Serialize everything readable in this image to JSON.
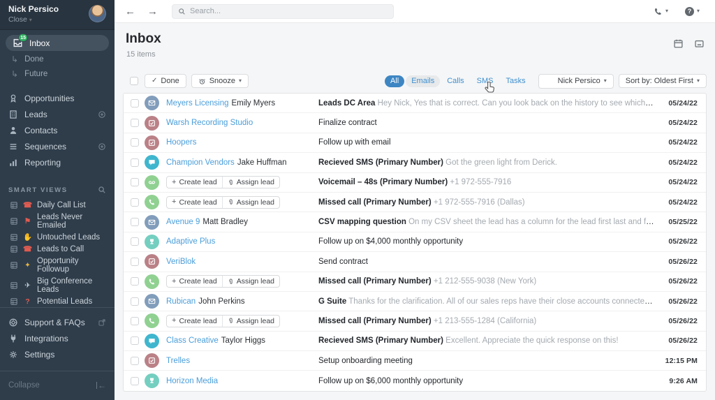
{
  "colors": {
    "accent_blue": "#4a9eda",
    "filter_active_bg": "#3d86c3",
    "badge_green": "#2eae5f",
    "icon_email": "#819dbb",
    "icon_task": "#ba8187",
    "icon_sms": "#3fb6ce",
    "icon_call": "#90d191",
    "icon_opportunity": "#74cfc0",
    "sidebar_bg": "#2f3d4b"
  },
  "glyphs": {
    "back": "←",
    "forward": "→",
    "caret": "▾",
    "sub_arrow": "↳",
    "check": "✓",
    "plus": "+",
    "question": "?"
  },
  "sidebar": {
    "user": {
      "name": "Nick Persico",
      "org": "Close"
    },
    "inbox": {
      "label": "Inbox",
      "badge": "15"
    },
    "sub_items": [
      {
        "label": "Done"
      },
      {
        "label": "Future"
      }
    ],
    "nav": [
      {
        "label": "Opportunities",
        "icon": "award-icon"
      },
      {
        "label": "Leads",
        "icon": "building-icon",
        "plus": true
      },
      {
        "label": "Contacts",
        "icon": "person-icon"
      },
      {
        "label": "Sequences",
        "icon": "lines-icon",
        "plus": true
      },
      {
        "label": "Reporting",
        "icon": "chart-icon"
      }
    ],
    "smart_views": {
      "title": "SMART VIEWS",
      "items": [
        {
          "label": "Daily Call List",
          "emoji": "☎"
        },
        {
          "label": "Leads Never Emailed",
          "emoji": "⚑"
        },
        {
          "label": "Untouched Leads",
          "emoji": "✋"
        },
        {
          "label": "Leads to Call",
          "emoji": "☎"
        },
        {
          "label": "Opportunity Followup",
          "emoji": "✦"
        },
        {
          "label": "Big Conference Leads",
          "emoji": "✈"
        },
        {
          "label": "Potential Leads",
          "emoji": "?"
        }
      ]
    },
    "bottom": [
      {
        "label": "Support & FAQs"
      },
      {
        "label": "Integrations"
      },
      {
        "label": "Settings"
      }
    ],
    "collapse_label": "Collapse"
  },
  "topbar": {
    "search_placeholder": "Search..."
  },
  "header": {
    "title": "Inbox",
    "count": "15 items"
  },
  "toolbar": {
    "done_label": "Done",
    "snooze_label": "Snooze",
    "filters": [
      "All",
      "Emails",
      "Calls",
      "SMS",
      "Tasks"
    ],
    "active_filter": "All",
    "hovered_filter": "Emails",
    "user_filter": "Nick Persico",
    "sort_label": "Sort by: Oldest First"
  },
  "buttons": {
    "create_lead": "Create lead",
    "assign_lead": "Assign lead"
  },
  "rows": [
    {
      "type": "email",
      "lead": "Meyers Licensing",
      "contact": "Emily Myers",
      "subject": "Leads DC Area",
      "preview": "Hey Nick, Yes that is correct. Can you look back on the history to see which leads were Washington D.C. and then update...",
      "date": "05/24/22"
    },
    {
      "type": "task",
      "lead": "Warsh Recording Studio",
      "subject": "Finalize contract",
      "date": "05/24/22"
    },
    {
      "type": "task",
      "lead": "Hoopers",
      "subject": "Follow up with email",
      "date": "05/24/22"
    },
    {
      "type": "sms",
      "lead": "Champion Vendors",
      "contact": "Jake Huffman",
      "subject": "Recieved SMS (Primary Number)",
      "preview": "Got the green light from Derick.",
      "date": "05/24/22"
    },
    {
      "type": "voicemail",
      "buttons": true,
      "subject": "Voicemail – 48s (Primary Number)",
      "preview": "+1 972-555-7916",
      "date": "05/24/22"
    },
    {
      "type": "call",
      "buttons": true,
      "subject": "Missed call (Primary Number)",
      "preview": "+1 972-555-7916 (Dallas)",
      "date": "05/24/22"
    },
    {
      "type": "email",
      "lead": "Avenue 9",
      "contact": "Matt Bradley",
      "subject": "CSV mapping question",
      "preview": "On my CSV sheet the lead has a column for the lead first last and full name. Should I map the column titled \"first na...",
      "date": "05/25/22"
    },
    {
      "type": "opportunity",
      "lead": "Adaptive Plus",
      "subject": "Follow up on $4,000 monthly opportunity",
      "date": "05/26/22"
    },
    {
      "type": "task",
      "lead": "VeriBlok",
      "subject": "Send contract",
      "date": "05/26/22"
    },
    {
      "type": "call",
      "buttons": true,
      "subject": "Missed call (Primary Number)",
      "preview": "+1 212-555-9038 (New York)",
      "date": "05/26/22"
    },
    {
      "type": "email",
      "lead": "Rubican",
      "contact": "John Perkins",
      "subject": "G Suite",
      "preview": "Thanks for the clarification. All of our sales reps have their close accounts connected to our G Suites. This connection lets all send...",
      "date": "05/26/22"
    },
    {
      "type": "call",
      "buttons": true,
      "subject": "Missed call (Primary Number)",
      "preview": "+1 213-555-1284 (California)",
      "date": "05/26/22"
    },
    {
      "type": "sms",
      "lead": "Class Creative",
      "contact": "Taylor Higgs",
      "subject": "Recieved SMS (Primary Number)",
      "preview": "Excellent. Appreciate the quick response on this!",
      "date": "05/26/22"
    },
    {
      "type": "task",
      "lead": "Trelles",
      "subject": "Setup onboarding meeting",
      "date": "12:15 PM"
    },
    {
      "type": "opportunity",
      "lead": "Horizon Media",
      "subject": "Follow up on $6,000 monthly opportunity",
      "date": "9:26 AM"
    }
  ]
}
